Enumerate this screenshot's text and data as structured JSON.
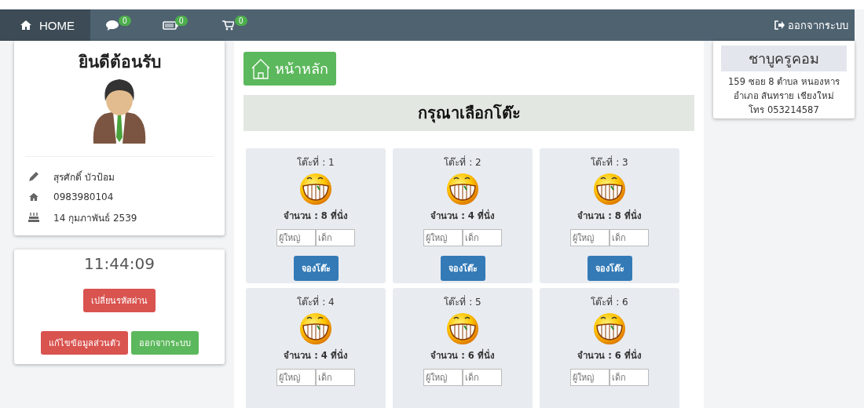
{
  "navbar": {
    "items": [
      {
        "kind": "home",
        "label": "HOME",
        "selected": true
      },
      {
        "kind": "chat",
        "badge": "0",
        "selected": false
      },
      {
        "kind": "battery",
        "badge": "0",
        "selected": false
      },
      {
        "kind": "cart",
        "badge": "0",
        "selected": false
      }
    ],
    "logout": "ออกจากระบบ"
  },
  "profile": {
    "title": "ยินดีต้อนรับ",
    "details": [
      {
        "kind": "pencil",
        "text": "สุรศักดิ์ บัวป้อม"
      },
      {
        "kind": "home",
        "text": "0983980104"
      },
      {
        "kind": "cake",
        "text": "14 กุมภาพันธ์ 2539"
      }
    ]
  },
  "clock": {
    "time": "11:44:09",
    "buttons": [
      {
        "kind": "danger",
        "label": "เปลี่ยนรหัสผ่าน"
      },
      {
        "kind": "danger",
        "label": "แก้ไขข้อมูลส่วนตัว"
      },
      {
        "kind": "success",
        "label": "ออกจากระบบ"
      }
    ]
  },
  "main": {
    "home_button": "หน้าหลัก",
    "heading": "กรุณาเลือกโต๊ะ",
    "tables": [
      {
        "title": "โต๊ะที่ : 1",
        "seats": "จำนวน : 8 ที่นั่ง",
        "adult_placeholder": "ผู้ใหญ่",
        "child_placeholder": "เด็ก",
        "button": "จองโต๊ะ"
      },
      {
        "title": "โต๊ะที่ : 2",
        "seats": "จำนวน : 4 ที่นั่ง",
        "adult_placeholder": "ผู้ใหญ่",
        "child_placeholder": "เด็ก",
        "button": "จองโต๊ะ"
      },
      {
        "title": "โต๊ะที่ : 3",
        "seats": "จำนวน : 8 ที่นั่ง",
        "adult_placeholder": "ผู้ใหญ่",
        "child_placeholder": "เด็ก",
        "button": "จองโต๊ะ"
      },
      {
        "title": "โต๊ะที่ : 4",
        "seats": "จำนวน : 4 ที่นั่ง",
        "adult_placeholder": "ผู้ใหญ่",
        "child_placeholder": "เด็ก"
      },
      {
        "title": "โต๊ะที่ : 5",
        "seats": "จำนวน : 6 ที่นั่ง",
        "adult_placeholder": "ผู้ใหญ่",
        "child_placeholder": "เด็ก"
      },
      {
        "title": "โต๊ะที่ : 6",
        "seats": "จำนวน : 6 ที่นั่ง",
        "adult_placeholder": "ผู้ใหญ่",
        "child_placeholder": "เด็ก"
      }
    ]
  },
  "shop": {
    "name": "ชาบูครูคอม",
    "address": "159 ซอย 8 ตำบล หนองหาร อำเภอ สันทราย เชียงใหม่",
    "phone": "โทร 053214587"
  }
}
